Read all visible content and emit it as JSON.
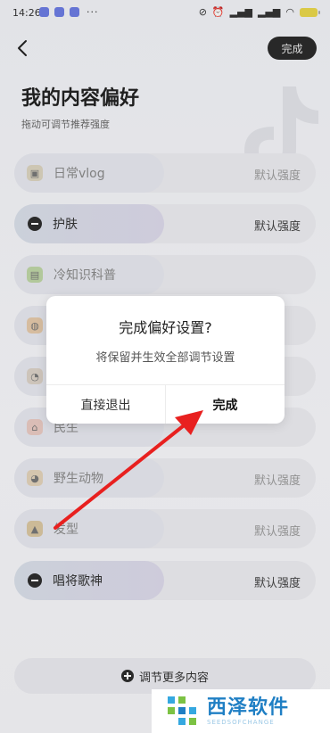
{
  "status_bar": {
    "time": "14:26",
    "dots": "···"
  },
  "header": {
    "done_label": "完成",
    "title": "我的内容偏好",
    "subtitle": "拖动可调节推荐强度"
  },
  "items": [
    {
      "label": "日常vlog",
      "strength": "默认强度",
      "active": false,
      "icon": "vlog-icon"
    },
    {
      "label": "护肤",
      "strength": "默认强度",
      "active": true,
      "icon": "minus-circle-icon"
    },
    {
      "label": "冷知识科普",
      "strength": "",
      "active": false,
      "icon": "book-icon"
    },
    {
      "label": "",
      "strength": "",
      "active": false,
      "icon": "food-icon"
    },
    {
      "label": "",
      "strength": "",
      "active": false,
      "icon": "car-icon"
    },
    {
      "label": "民生",
      "strength": "",
      "active": false,
      "icon": "house-icon"
    },
    {
      "label": "野生动物",
      "strength": "默认强度",
      "active": false,
      "icon": "animal-icon"
    },
    {
      "label": "发型",
      "strength": "默认强度",
      "active": false,
      "icon": "hair-icon"
    },
    {
      "label": "唱将歌神",
      "strength": "默认强度",
      "active": true,
      "icon": "minus-circle-icon"
    }
  ],
  "more": {
    "label": "调节更多内容"
  },
  "dialog": {
    "title": "完成偏好设置?",
    "message": "将保留并生效全部调节设置",
    "cancel_label": "直接退出",
    "confirm_label": "完成"
  },
  "brand": {
    "name": "西泽软件",
    "sub": "SEEDSOFCHANGE"
  },
  "colors": {
    "accent_dark": "#2b2b2b",
    "arrow": "#e8201f",
    "brand": "#1f7fc4"
  }
}
